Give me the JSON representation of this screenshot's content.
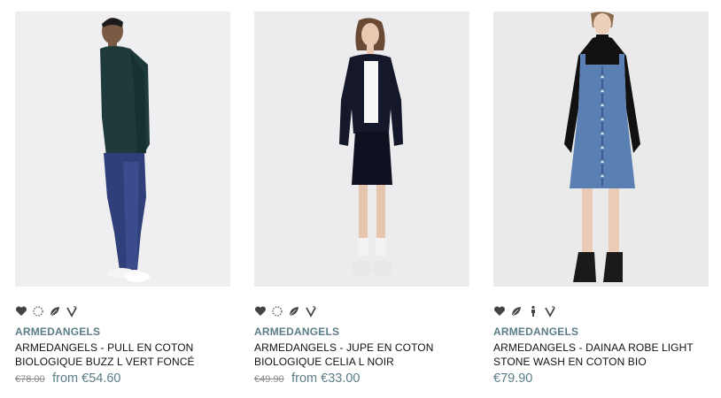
{
  "colors": {
    "brand": "#5b7d86",
    "price": "#5b7d86",
    "old_price": "#888888",
    "icon": "#444444"
  },
  "products": [
    {
      "image_icon": "man-model-green-sweater-jeans",
      "badges": [
        "heart-icon",
        "circle-dots-icon",
        "leaf-icon",
        "vegan-v-icon"
      ],
      "brand": "ARMEDANGELS",
      "title_line1": "ARMEDANGELS - PULL EN COTON",
      "title_line2": "BIOLOGIQUE BUZZ L VERT FONCÉ",
      "old_price": "€78.00",
      "price": "from €54.60"
    },
    {
      "image_icon": "woman-model-black-jacket-skirt",
      "badges": [
        "heart-icon",
        "circle-dots-icon",
        "leaf-icon",
        "vegan-v-icon"
      ],
      "brand": "ARMEDANGELS",
      "title_line1": "ARMEDANGELS - JUPE EN COTON",
      "title_line2": "BIOLOGIQUE CELIA L NOIR",
      "old_price": "€49.90",
      "price": "from €33.00"
    },
    {
      "image_icon": "woman-model-denim-dress",
      "badges": [
        "heart-icon",
        "leaf-icon",
        "person-icon",
        "vegan-v-icon"
      ],
      "brand": "ARMEDANGELS",
      "title_line1": "ARMEDANGELS - DAINAA ROBE LIGHT",
      "title_line2": "STONE WASH EN COTON BIO",
      "old_price": "",
      "price": "€79.90"
    }
  ]
}
